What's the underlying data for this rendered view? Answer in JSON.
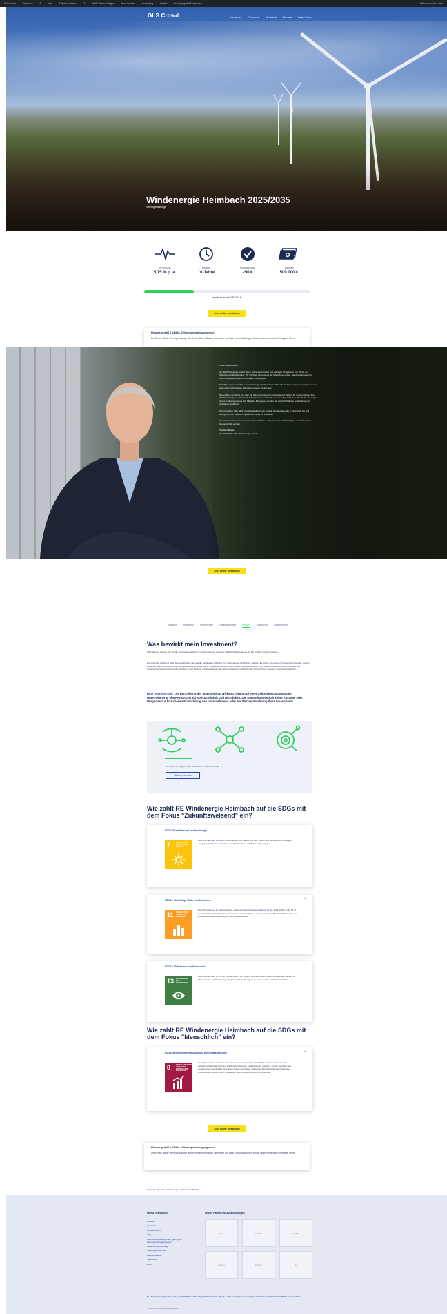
{
  "admin_bar": {
    "items": [
      "GLS Crowd",
      "Customize",
      "0",
      "New",
      "Projekt bearbeiten",
      "0",
      "WWU Offene Anfragen",
      "Neue Kreative",
      "Anmeldung",
      "Gestalt",
      "Beteiligungsdetails Anzeigen"
    ],
    "greeting": "Willkommen, Tom Kumi"
  },
  "header": {
    "logo": "GLS Crowd",
    "nav": [
      "Investieren",
      "Finanzieren",
      "Mediathek",
      "Über uns",
      "Login / Konto"
    ]
  },
  "hero": {
    "title": "Windenergie Heimbach 2025/2035",
    "subtitle": "Vermögensanlage"
  },
  "stats": [
    {
      "icon": "pulse-icon",
      "label": "Verzinsung",
      "value": "5,75 % p. a."
    },
    {
      "icon": "clock-icon",
      "label": "Laufzeit",
      "value": "10 Jahre"
    },
    {
      "icon": "check-circle-icon",
      "label": "Mindestbetrag",
      "value": "250 €"
    },
    {
      "icon": "money-stack-icon",
      "label": "Volumen",
      "value": "500.000 €"
    }
  ],
  "funding": {
    "progress_percent": 30,
    "raised_text": "bereits finanziert: 150.000 €",
    "progress_color": "#2fcf5f"
  },
  "cta": {
    "label": "Jetzt online investieren"
  },
  "notice": {
    "title": "Hinweis gemäß § 13 Abs. 2 Vermögensanlagengesetz:",
    "body": "Der Erwerb dieser Vermögensanlage ist mit erheblichen Risiken verbunden und kann zum vollständigen Verlust des eingesetzten Vermögens führen."
  },
  "letter": {
    "paragraphs": [
      "Liebe Anlegerinnen,",
      "die RE Windenergie GmbH ist ein führender Investor und gefragter Projektierer von Wind- und Solarparks in Deutschland. Wir möchten Ihnen heute die Möglichkeit geben, Sie direkt an unserem neuen Windparkprojekt in Heimbach zu beteiligen.",
      "Seit 2013 setzen wir diese verantwortungsvolle Projekte im Bereich der Erneuerbaren Energien um und bauen den nachhaltigen Wandel in unserer Region aus.",
      "Dieser Weg verspricht uns aber ein faires Investment mit Rendite und Nutzen für unsere Region. Die Windkraftanlagen in Heimbach liefern bereits verlässlich sauberen Strom für viele Haushalte und tragen direkt zur Energiewende bei. Mit jeder Beteiligung werden Sie selbst Teil dieser Entwicklung und profitieren langfristig.",
      "Ihre Investition über GLS Crowd trägt direkt zum Ausbau der Windenergie in Heimbach bei und ermöglicht uns, weitere Projekte nachhaltig zu realisieren.",
      "Gemeinsam können wir mehr erreichen. Ich freue mich, wenn Sie sich beteiligen und Teil unserer Gemeinschaft werden.",
      "Thomas Kranz",
      "Geschäftsführer RE Windenergie GmbH"
    ]
  },
  "tabs": {
    "items": [
      "Überblick",
      "Investment",
      "Unternehmen",
      "Zusatzleistungen",
      "Wirkung",
      "Dokumente",
      "Anlegerfragen"
    ],
    "active_index": 4
  },
  "impact": {
    "heading": "Was bewirkt mein Investment?",
    "intro": "Wir haben es gefragt, wie wir die eingesetzte Wirkung Ihrer Investitionen in Bezug auf Nachhaltigkeitsziele für Sie greifbar machen können.",
    "body": "Das folgende Wirkprofil stellt dieses Vorhaben dar, das die nachhaltige Wirkung von Unternehmen sichtbar zu machen. Es wurde von unserem Kooperationspartner, der GLS Bank, auf Basis der eigenen Nachhaltigkeitskriterien sowie der 17 Sustainable Development Goals (SDGs) entwickelt. Das Ergebnis beruht auf den Aussagen des Unternehmens auf Fragen zu der Wirkung seiner Projekte und Dienstleistungen. Diese Bewertung soll Ihnen die Wirkung Ihres Investments veranschaulichen.",
    "disclaimer": "Bitte beachten Sie: Die Darstellung der angestrebten Wirkung beruht auf einer Selbsteinschätzung des Unternehmens, ohne Anspruch auf Vollständigkeit und Richtigkeit. Die Darstellung enthält keine Aussage oder Prognose zur finanziellen Entwicklung des Unternehmens oder zur Werteentwicklung Ihres Investments.",
    "disclaimer_lead": "Bitte beachten Sie:",
    "icons": [
      "wind-cycle-icon",
      "network-icon",
      "target-search-icon"
    ],
    "caption": "Die Logik der Wirkpyramide verdeutlicht Zusammenhänge.",
    "button": "Wirkung erkunden"
  },
  "sdg_groups": [
    {
      "heading": "Wie zahlt RE Windenergie Heimbach auf die SDGs mit dem Fokus \"Zukunftsweisend\" ein?",
      "cards": [
        {
          "title": "SDG 7: Bezahlbare und saubere Energie",
          "number": "7",
          "tile_text": "BEZAHLBARE UND SAUBERE ENERGIE",
          "color": "#fcc30b",
          "glyph": "sun-power-icon",
          "text": "Das Unternehmen investiert ausschließlich in Projekte aus dem Bereich der Erneuerbaren Energien. Ausgehend ist dabei der Ausbau von Photovoltaik- und Windenergieanlagen."
        },
        {
          "title": "SDG 11: Nachhaltige Städte und Gemeinden",
          "number": "11",
          "tile_text": "NACHHALTIGE STÄDTE UND GEMEINDEN",
          "color": "#fd9d24",
          "glyph": "city-icon",
          "text": "Das Unternehmen ist mittelständisch und begünstigt. Hauptgeschäftssitz ist die Stadt Aachen. Die 50 % Gesellschaftsanteile hält. Das Unternehmen betreibt Städte und Gemeinden im Bereich Photovoltaik und ermöglicht Bürgerbeteiligung auf kommunaler Ebene."
        },
        {
          "title": "SDG 15: Maßnahmen zum Klimaschutz",
          "number": "13",
          "tile_text": "MASSNAHMEN ZUM KLIMASCHUTZ",
          "color": "#3f7e44",
          "glyph": "eye-globe-icon",
          "text": "Das Unternehmen ist es, die Klimaschutz in der Region voranzutreiben. Hierzu errichtet und betreibt es Photovoltaik- und Windenergieanlagen und betreibt eigene Leitsysteme für die Elektromobilität."
        }
      ]
    },
    {
      "heading": "Wie zahlt RE Windenergie Heimbach auf die SDGs mit dem Fokus \"Menschlich\" ein?",
      "cards": [
        {
          "title": "SDG 8: Menschenwürdige Arbeit und Wirtschaftswachstum",
          "number": "8",
          "tile_text": "MENSCHENWÜRDIGE ARBEIT UND WIRTSCHAFTS-WACHSTUM",
          "color": "#a21942",
          "glyph": "growth-chart-icon",
          "text": "Das Unternehmen orientiert sich streng an den Regeln der ISO 26000. Es sind entsprechende Jahresberichterstattungen zur Prüfgeschichte sowie Lagebericht zu erstellen. Zudem berichtet das Unternehmen regelmäßig gegenüber seinen Aktionären und seinen Nutzerbeteiligungen über die Auswirkungen sowie an den Tarifpartner des öffentlichen Nutzens gegenüber."
        }
      ]
    }
  ],
  "breadcrumb": "Startseite / Projekte / Windenergie Heimbach 2025/2035",
  "footer": {
    "links_title": "Hilfe & Rechtliches",
    "links": [
      "Kontakt",
      "Newsletter",
      "Anlegerbereich",
      "FAQ",
      "Vermittlungsbedingungen (gem. § 2a Vermögensanlagengesetz)",
      "Datenschutzerklärung",
      "Haftungsausschluss",
      "Risikohinweise",
      "Impressum",
      "AGB"
    ],
    "partners_title": "Unsere Partner und Auszeichnungen",
    "partners": [
      "GLS",
      "Partner",
      "Partner",
      "Partner",
      "Partner",
      "C"
    ],
    "note": "Der Betreiber (frei) kommt die im der GLS Crowdfunding Plattform keine. Wenn es für weiterleiten Sie nach Lisztkantbar und Partner der Plattform vermittelt.",
    "copyright": "© 2025 GLS Crowdfunding GmbH"
  }
}
